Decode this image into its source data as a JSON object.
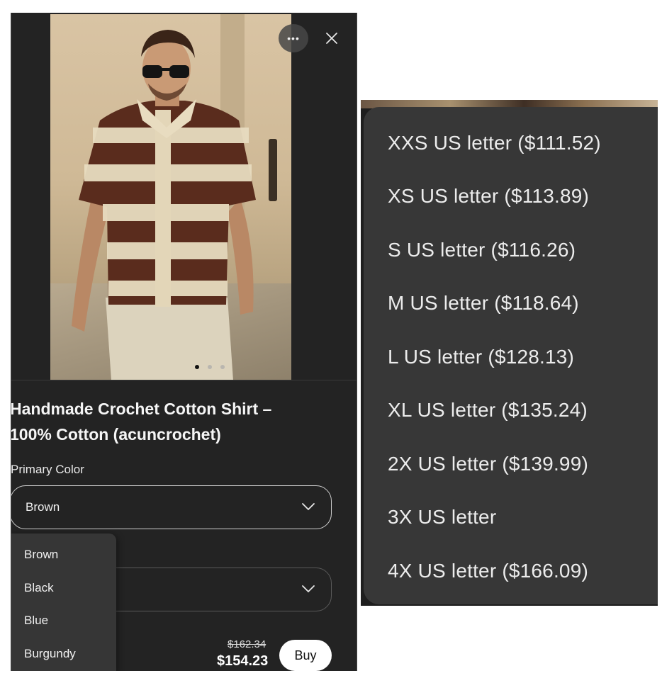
{
  "product": {
    "title_line1": "Handmade Crochet Cotton Shirt –",
    "title_line2": "100% Cotton (acuncrochet)",
    "primary_color_label": "Primary Color",
    "selected_color": "Brown",
    "color_options": [
      "Brown",
      "Black",
      "Blue",
      "Burgundy"
    ],
    "price_original": "$162.34",
    "price_current": "$154.23",
    "buy_label": "Buy",
    "image_dots": 3,
    "active_dot": 1
  },
  "header": {
    "more_icon": "ellipsis-icon",
    "close_icon": "close-icon"
  },
  "size_menu": {
    "options": [
      "XXS US letter ($111.52)",
      "XS US letter ($113.89)",
      "S US letter ($116.26)",
      "M US letter ($118.64)",
      "L US letter ($128.13)",
      "XL US letter ($135.24)",
      "2X US letter ($139.99)",
      "3X US letter",
      "4X US letter ($166.09)"
    ]
  },
  "colors": {
    "panel_bg": "#232323",
    "menu_bg": "#373737",
    "text": "#f1f1f1",
    "buy_bg": "#ffffff"
  }
}
